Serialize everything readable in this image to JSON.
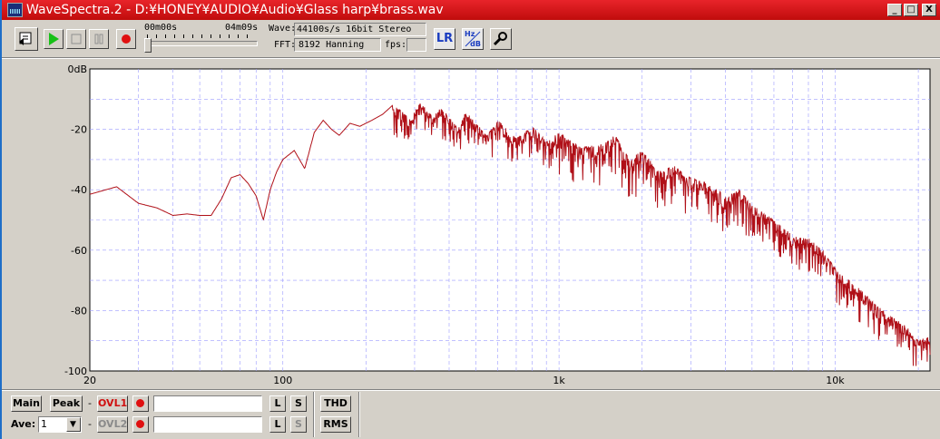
{
  "window": {
    "title": "WaveSpectra.2 - D:¥HONEY¥AUDIO¥Audio¥Glass harp¥brass.wav",
    "min_glyph": "_",
    "max_glyph": "□",
    "close_glyph": "X"
  },
  "toolbar": {
    "time_start": "00m00s",
    "time_end": "04m09s",
    "wave_label": "Wave:",
    "wave_value": "44100s/s 16bit Stereo",
    "fft_label": "FFT:",
    "fft_value": "8192 Hanning",
    "fps_label": "fps:",
    "fps_value": "",
    "lr_button": "LR",
    "hz_db_button_top": "Hz",
    "hz_db_button_bottom": "dB"
  },
  "bottom": {
    "main": "Main",
    "peak": "Peak",
    "ovl1": "OVL1",
    "ovl2": "OVL2",
    "dash": "-",
    "l": "L",
    "s": "S",
    "thd": "THD",
    "rms": "RMS",
    "ave_label": "Ave:",
    "ave_value": "1",
    "ovl1_input": "",
    "ovl2_input": ""
  },
  "colors": {
    "trace": "#b01018",
    "grid": "#9a9aff",
    "plot_bg": "#ffffff",
    "titlebar": "#d61418"
  },
  "chart_data": {
    "type": "line",
    "title": "",
    "xlabel": "",
    "ylabel": "",
    "x_scale": "log",
    "xlim": [
      20,
      22050
    ],
    "ylim": [
      -100,
      0
    ],
    "x_ticks": [
      {
        "value": 20,
        "label": "20"
      },
      {
        "value": 100,
        "label": "100"
      },
      {
        "value": 1000,
        "label": "1k"
      },
      {
        "value": 10000,
        "label": "10k"
      }
    ],
    "y_ticks": [
      {
        "value": 0,
        "label": "0dB"
      },
      {
        "value": -20,
        "label": "-20"
      },
      {
        "value": -40,
        "label": "-40"
      },
      {
        "value": -60,
        "label": "-60"
      },
      {
        "value": -80,
        "label": "-80"
      },
      {
        "value": -100,
        "label": "-100"
      }
    ],
    "grid": true,
    "series": [
      {
        "color": "#b01018",
        "x": [
          20,
          25,
          30,
          35,
          40,
          45,
          50,
          55,
          60,
          65,
          70,
          75,
          80,
          85,
          90,
          95,
          100,
          110,
          120,
          130,
          140,
          150,
          160,
          175,
          190,
          210,
          230,
          250,
          270,
          290,
          310,
          330,
          350,
          370,
          400,
          430,
          460,
          500,
          550,
          600,
          650,
          700,
          800,
          900,
          1000,
          1200,
          1400,
          1600,
          1800,
          2000,
          2300,
          2600,
          3000,
          3500,
          4000,
          4500,
          5000,
          6000,
          7000,
          8000,
          9000,
          10000,
          12000,
          14000,
          16000,
          18000,
          20000,
          22050
        ],
        "y": [
          -41.5,
          -39,
          -44.5,
          -46,
          -48.5,
          -48,
          -48.5,
          -48.5,
          -43,
          -36,
          -35,
          -38,
          -42,
          -50,
          -40,
          -34,
          -30,
          -27,
          -33,
          -21,
          -17,
          -20,
          -22,
          -18,
          -19,
          -17,
          -15,
          -12,
          -14,
          -17,
          -11,
          -13,
          -16,
          -13,
          -15,
          -20,
          -14,
          -18,
          -22,
          -17,
          -20,
          -23,
          -19,
          -24,
          -21,
          -26,
          -25,
          -22,
          -30,
          -27,
          -34,
          -32,
          -36,
          -38,
          -42,
          -40,
          -45,
          -50,
          -55,
          -56,
          -60,
          -66,
          -72,
          -78,
          -82,
          -85,
          -90,
          -88
        ]
      }
    ]
  }
}
